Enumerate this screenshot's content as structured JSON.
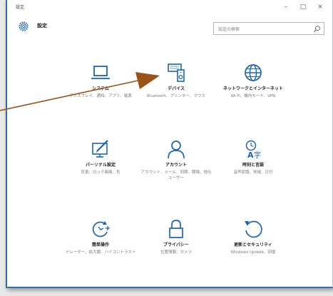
{
  "window": {
    "title": "設定",
    "minimize_glyph": "–",
    "maximize_glyph": "□",
    "close_glyph": "×"
  },
  "header": {
    "title": "設定",
    "icon": "gear-icon"
  },
  "search": {
    "placeholder": "設定の検索",
    "icon": "search-icon"
  },
  "tiles": [
    {
      "title": "システム",
      "desc": "ディスプレイ、通知、アプリ、電源",
      "icon": "laptop-icon"
    },
    {
      "title": "デバイス",
      "desc": "Bluetooth、プリンター、マウス",
      "icon": "devices-icon"
    },
    {
      "title": "ネットワークとインターネット",
      "desc": "Wi-Fi、機内モード、VPN",
      "icon": "globe-icon"
    },
    {
      "title": "パーソナル設定",
      "desc": "背景、ロック画面、色",
      "icon": "personalization-icon"
    },
    {
      "title": "アカウント",
      "desc": "アカウント、メール、同期、職場、他のユーザー",
      "icon": "person-icon"
    },
    {
      "title": "時刻と言語",
      "desc": "音声認識、地域、日付",
      "icon": "time-language-icon"
    },
    {
      "title": "簡単操作",
      "desc": "ナレーター、拡大鏡、ハイコントラスト",
      "icon": "ease-of-access-icon"
    },
    {
      "title": "プライバシー",
      "desc": "位置情報、カメラ",
      "icon": "lock-icon"
    },
    {
      "title": "更新とセキュリティ",
      "desc": "Windows Update、回復",
      "icon": "update-icon"
    }
  ],
  "colors": {
    "accent": "#2e6fb0",
    "icon": "#1a64b8",
    "annotation_arrow": "#9a5216"
  }
}
